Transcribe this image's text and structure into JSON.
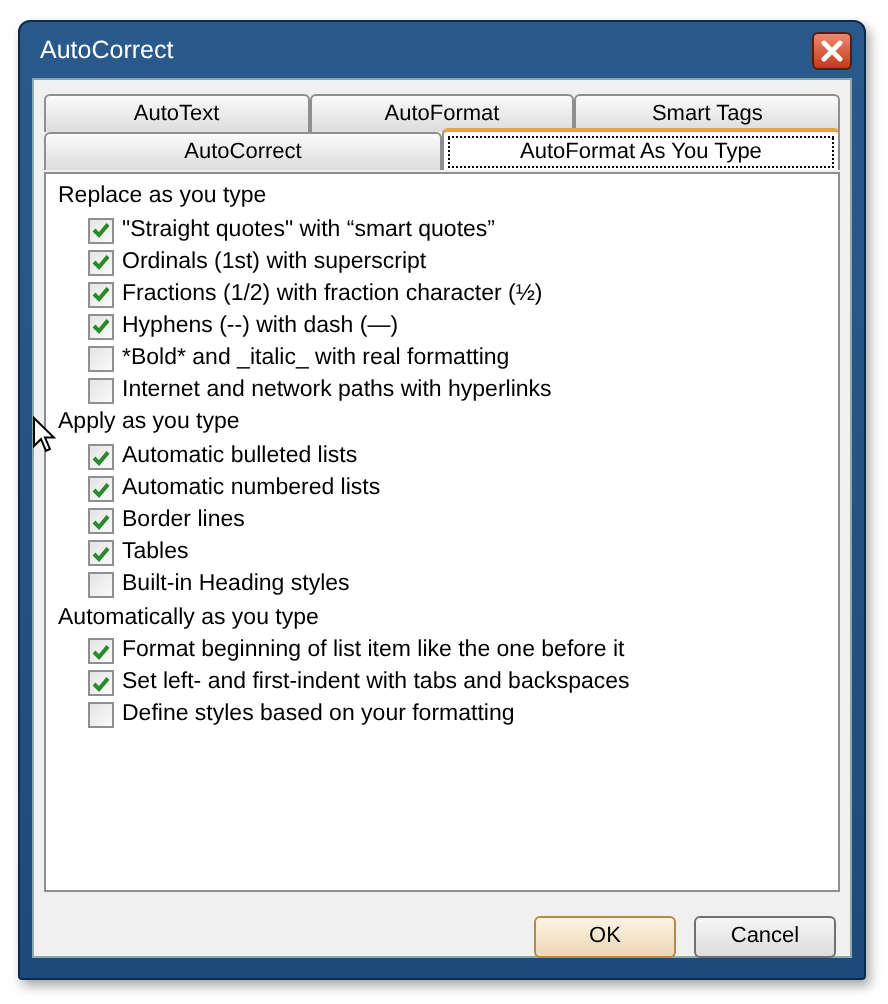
{
  "window": {
    "title": "AutoCorrect"
  },
  "tab_rows": [
    [
      {
        "label": "AutoText",
        "selected": false
      },
      {
        "label": "AutoFormat",
        "selected": false
      },
      {
        "label": "Smart Tags",
        "selected": false
      }
    ],
    [
      {
        "label": "AutoCorrect",
        "selected": false
      },
      {
        "label": "AutoFormat As You Type",
        "selected": true
      }
    ]
  ],
  "sections": [
    {
      "heading": "Replace as you type",
      "options": [
        {
          "label": "\"Straight quotes\" with “smart quotes”",
          "checked": true
        },
        {
          "label": "Ordinals (1st) with superscript",
          "checked": true
        },
        {
          "label": "Fractions (1/2) with fraction character (½)",
          "checked": true
        },
        {
          "label": "Hyphens (--) with dash (—)",
          "checked": true
        },
        {
          "label": "*Bold* and _italic_ with real formatting",
          "checked": false
        },
        {
          "label": "Internet and network paths with hyperlinks",
          "checked": false
        }
      ]
    },
    {
      "heading": "Apply as you type",
      "options": [
        {
          "label": "Automatic bulleted lists",
          "checked": true
        },
        {
          "label": "Automatic numbered lists",
          "checked": true
        },
        {
          "label": "Border lines",
          "checked": true
        },
        {
          "label": "Tables",
          "checked": true
        },
        {
          "label": "Built-in Heading styles",
          "checked": false
        }
      ]
    },
    {
      "heading": "Automatically as you type",
      "options": [
        {
          "label": "Format beginning of list item like the one before it",
          "checked": true
        },
        {
          "label": "Set left- and first-indent with tabs and backspaces",
          "checked": true
        },
        {
          "label": "Define styles based on your formatting",
          "checked": false
        }
      ]
    }
  ],
  "buttons": [
    {
      "label": "OK",
      "default": true
    },
    {
      "label": "Cancel",
      "default": false
    }
  ]
}
